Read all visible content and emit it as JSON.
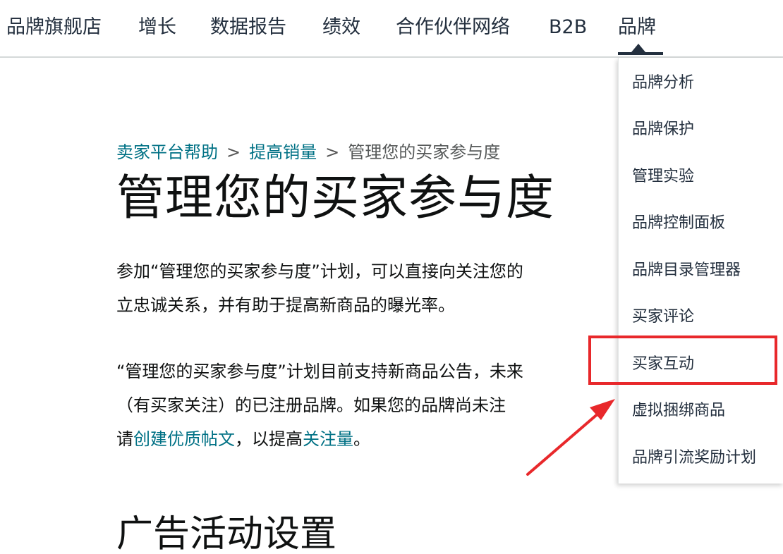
{
  "topnav": {
    "items": [
      {
        "label": "品牌旗舰店"
      },
      {
        "label": "增长"
      },
      {
        "label": "数据报告"
      },
      {
        "label": "绩效"
      },
      {
        "label": "合作伙伴网络"
      },
      {
        "label": "B2B"
      },
      {
        "label": "品牌"
      }
    ],
    "active": "品牌"
  },
  "breadcrumb": {
    "items": [
      "卖家平台帮助",
      "提高销量",
      "管理您的买家参与度"
    ],
    "separator": ">"
  },
  "main": {
    "title": "管理您的买家参与度",
    "paragraph1": {
      "line1": "参加“管理您的买家参与度”计划，可以直接向关注您的",
      "line2": "立忠诚关系，并有助于提高新商品的曝光率。"
    },
    "paragraph2": {
      "line1": "“管理您的买家参与度”计划目前支持新商品公告，未来",
      "line2": "（有买家关注）的已注册品牌。如果您的品牌尚未注",
      "line3_prefix": "请",
      "line3_link1": "创建优质帖文",
      "line3_middle": "，以提高",
      "line3_link2": "关注量",
      "line3_suffix": "。"
    },
    "section_heading": "广告活动设置"
  },
  "dropdown": {
    "items": [
      {
        "label": "品牌分析"
      },
      {
        "label": "品牌保护"
      },
      {
        "label": "管理实验"
      },
      {
        "label": "品牌控制面板"
      },
      {
        "label": "品牌目录管理器"
      },
      {
        "label": "买家评论"
      },
      {
        "label": "买家互动"
      },
      {
        "label": "虚拟捆绑商品"
      },
      {
        "label": "品牌引流奖励计划"
      }
    ],
    "highlighted": "买家互动"
  },
  "colors": {
    "link": "#007185",
    "nav_text": "#232f3e",
    "highlight": "#e8282b"
  }
}
